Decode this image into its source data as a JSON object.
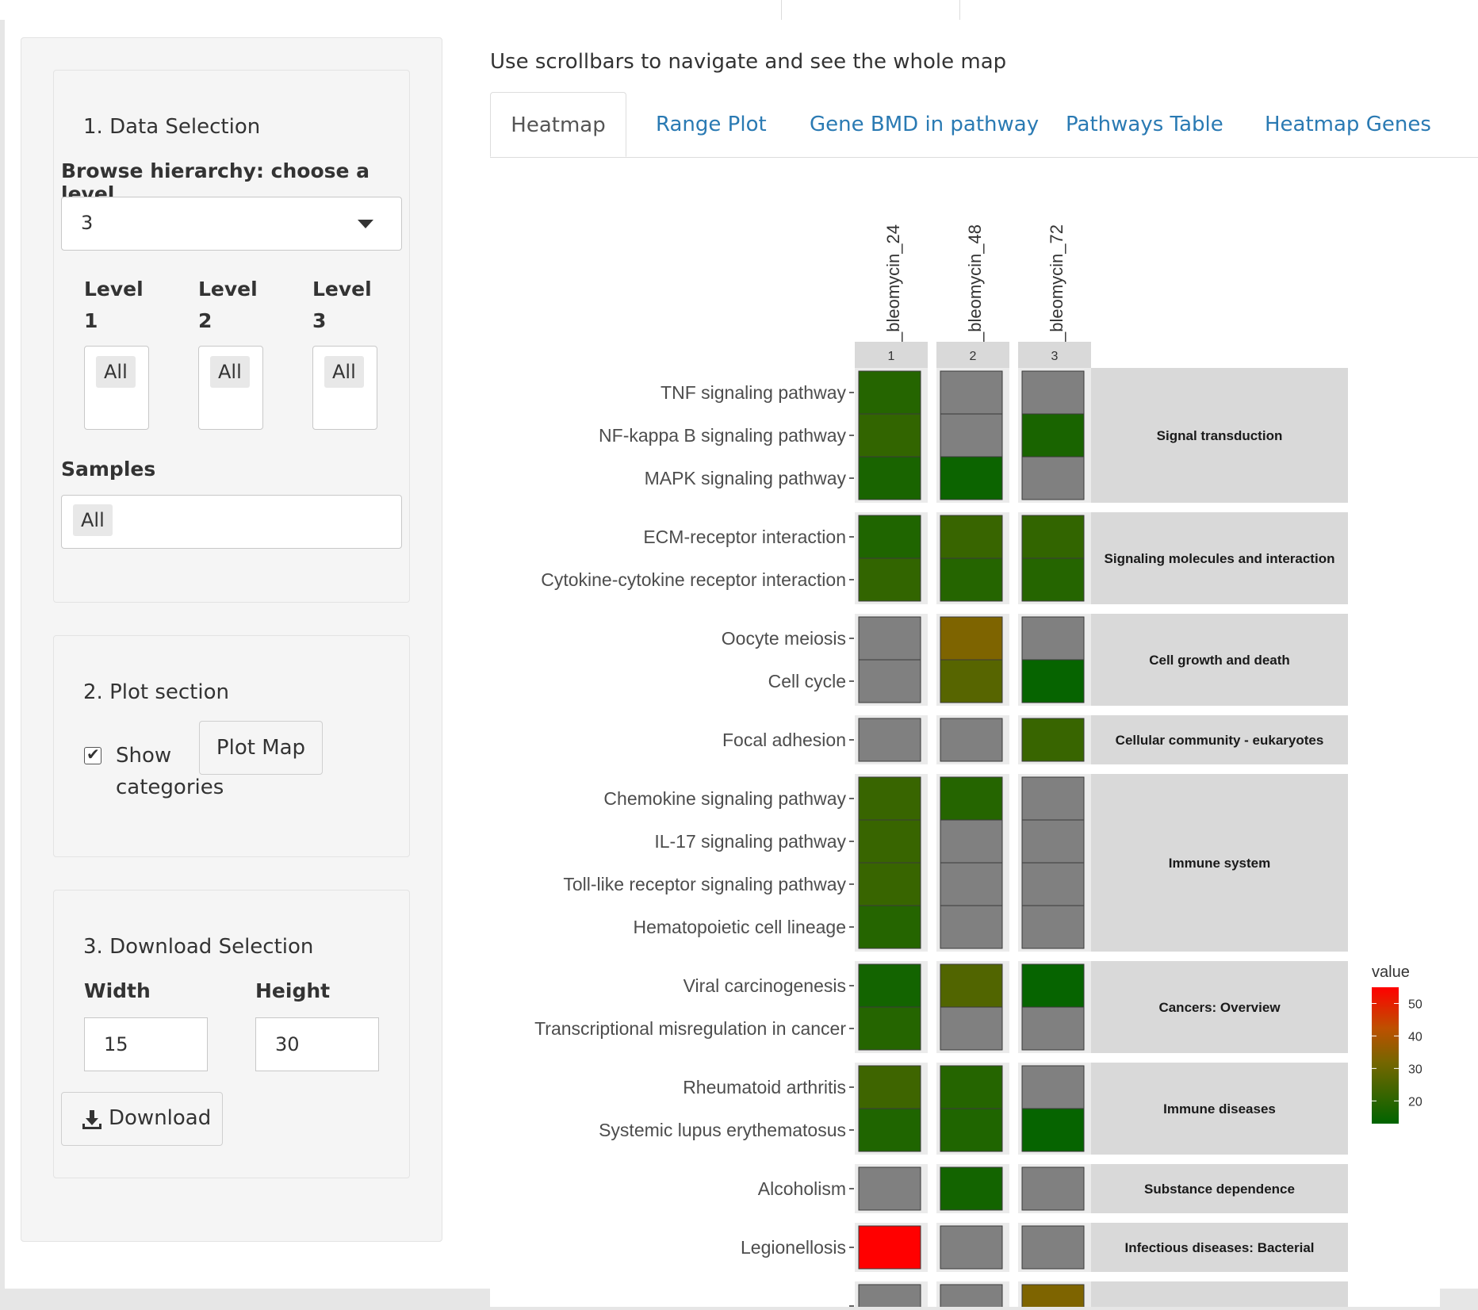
{
  "sidebar": {
    "data_selection": {
      "title": "1. Data Selection",
      "hierarchy_label": "Browse hierarchy: choose a level",
      "hierarchy_value": "3",
      "levels": [
        {
          "label_line1": "Level",
          "label_line2": "1",
          "value": "All"
        },
        {
          "label_line1": "Level",
          "label_line2": "2",
          "value": "All"
        },
        {
          "label_line1": "Level",
          "label_line2": "3",
          "value": "All"
        }
      ],
      "samples_label": "Samples",
      "samples_value": "All"
    },
    "plot_section": {
      "title": "2. Plot section",
      "show_categories_line1": "Show",
      "show_categories_line2": "categories",
      "show_categories_checked": true,
      "plot_button": "Plot Map"
    },
    "download_section": {
      "title": "3. Download Selection",
      "width_label": "Width",
      "height_label": "Height",
      "width_value": "15",
      "height_value": "30",
      "download_button": "Download"
    }
  },
  "main": {
    "hint": "Use scrollbars to navigate and see the whole map",
    "tabs": [
      {
        "label": "Heatmap",
        "active": true
      },
      {
        "label": "Range Plot",
        "active": false
      },
      {
        "label": "Gene BMD in pathway",
        "active": false
      },
      {
        "label": "Pathways Table",
        "active": false
      },
      {
        "label": "Heatmap Genes",
        "active": false
      }
    ]
  },
  "chart_data": {
    "type": "heatmap",
    "columns": [
      {
        "name": "_bleomycin_24",
        "strip": "1"
      },
      {
        "name": "_bleomycin_48",
        "strip": "2"
      },
      {
        "name": "_bleomycin_72",
        "strip": "3"
      }
    ],
    "legend": {
      "title": "value",
      "ticks": [
        20,
        30,
        40,
        50
      ],
      "range": [
        13,
        55
      ],
      "low_color": "#006400",
      "high_color": "#ff0000",
      "na_color": "#808080"
    },
    "groups": [
      {
        "category": "Signal transduction",
        "rows": [
          {
            "pathway": "TNF signaling pathway",
            "values": [
              19,
              null,
              null
            ]
          },
          {
            "pathway": "NF-kappa B signaling pathway",
            "values": [
              21,
              null,
              17
            ]
          },
          {
            "pathway": "MAPK signaling pathway",
            "values": [
              17,
              15,
              null
            ]
          }
        ]
      },
      {
        "category": "Signaling molecules and interaction",
        "rows": [
          {
            "pathway": "ECM-receptor interaction",
            "values": [
              18,
              22,
              21
            ]
          },
          {
            "pathway": "Cytokine-cytokine receptor interaction",
            "values": [
              21,
              19,
              19
            ]
          }
        ]
      },
      {
        "category": "Cell growth and death",
        "rows": [
          {
            "pathway": "Oocyte meiosis",
            "values": [
              null,
              33,
              null
            ]
          },
          {
            "pathway": "Cell cycle",
            "values": [
              null,
              27,
              14
            ]
          }
        ]
      },
      {
        "category": "Cellular community - eukaryotes",
        "rows": [
          {
            "pathway": "Focal adhesion",
            "values": [
              null,
              null,
              22
            ]
          }
        ]
      },
      {
        "category": "Immune system",
        "rows": [
          {
            "pathway": "Chemokine signaling pathway",
            "values": [
              22,
              19,
              null
            ]
          },
          {
            "pathway": "IL-17 signaling pathway",
            "values": [
              22,
              null,
              null
            ]
          },
          {
            "pathway": "Toll-like receptor signaling pathway",
            "values": [
              22,
              null,
              null
            ]
          },
          {
            "pathway": "Hematopoietic cell lineage",
            "values": [
              19,
              null,
              null
            ]
          }
        ]
      },
      {
        "category": "Cancers: Overview",
        "rows": [
          {
            "pathway": "Viral carcinogenesis",
            "values": [
              16,
              26,
              14
            ]
          },
          {
            "pathway": "Transcriptional misregulation in cancer",
            "values": [
              19,
              null,
              null
            ]
          }
        ]
      },
      {
        "category": "Immune diseases",
        "rows": [
          {
            "pathway": "Rheumatoid arthritis",
            "values": [
              23,
              19,
              null
            ]
          },
          {
            "pathway": "Systemic lupus erythematosus",
            "values": [
              18,
              18,
              14
            ]
          }
        ]
      },
      {
        "category": "Substance dependence",
        "rows": [
          {
            "pathway": "Alcoholism",
            "values": [
              null,
              16,
              null
            ]
          }
        ]
      },
      {
        "category": "Infectious diseases: Bacterial",
        "rows": [
          {
            "pathway": "Legionellosis",
            "values": [
              55,
              null,
              null
            ]
          }
        ]
      },
      {
        "category": "",
        "rows": [
          {
            "pathway": "",
            "values": [
              null,
              null,
              33
            ]
          }
        ]
      }
    ]
  }
}
